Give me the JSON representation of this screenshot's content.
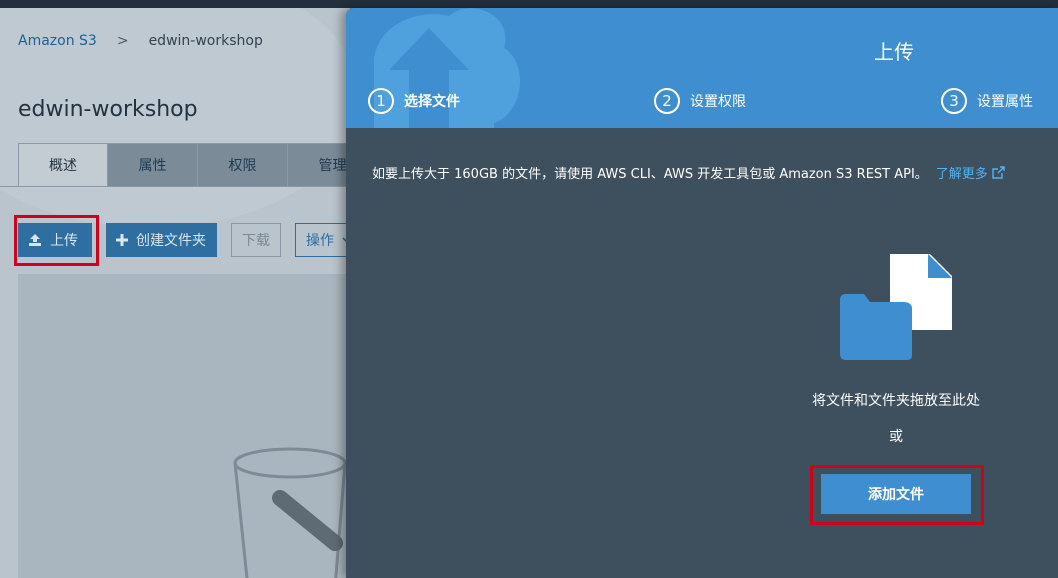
{
  "breadcrumb": {
    "root": "Amazon S3",
    "separator": ">",
    "current": "edwin-workshop"
  },
  "page": {
    "title": "edwin-workshop"
  },
  "tabs": [
    {
      "label": "概述",
      "active": true
    },
    {
      "label": "属性"
    },
    {
      "label": "权限"
    },
    {
      "label": "管理"
    }
  ],
  "actions": {
    "upload": "上传",
    "create_folder": "创建文件夹",
    "download": "下载",
    "operations": "操作"
  },
  "modal": {
    "title": "上传",
    "steps": [
      {
        "number": "1",
        "label": "选择文件",
        "active": true
      },
      {
        "number": "2",
        "label": "设置权限"
      },
      {
        "number": "3",
        "label": "设置属性"
      }
    ],
    "notice": "如要上传大于 160GB 的文件，请使用 AWS CLI、AWS 开发工具包或 Amazon S3 REST API。",
    "learn_more": "了解更多",
    "drop_text": "将文件和文件夹拖放至此处",
    "or_text": "或",
    "add_files": "添加文件"
  },
  "icons": {
    "upload": "upload-icon",
    "plus": "plus-icon",
    "chevron": "chevron-down-icon",
    "external": "external-link-icon",
    "drop": "file-and-folder-icon"
  },
  "colors": {
    "accent": "#3f8fd0",
    "modal_bg": "#3e4f5e",
    "link": "#53b3f4",
    "highlight": "#d0021b"
  }
}
